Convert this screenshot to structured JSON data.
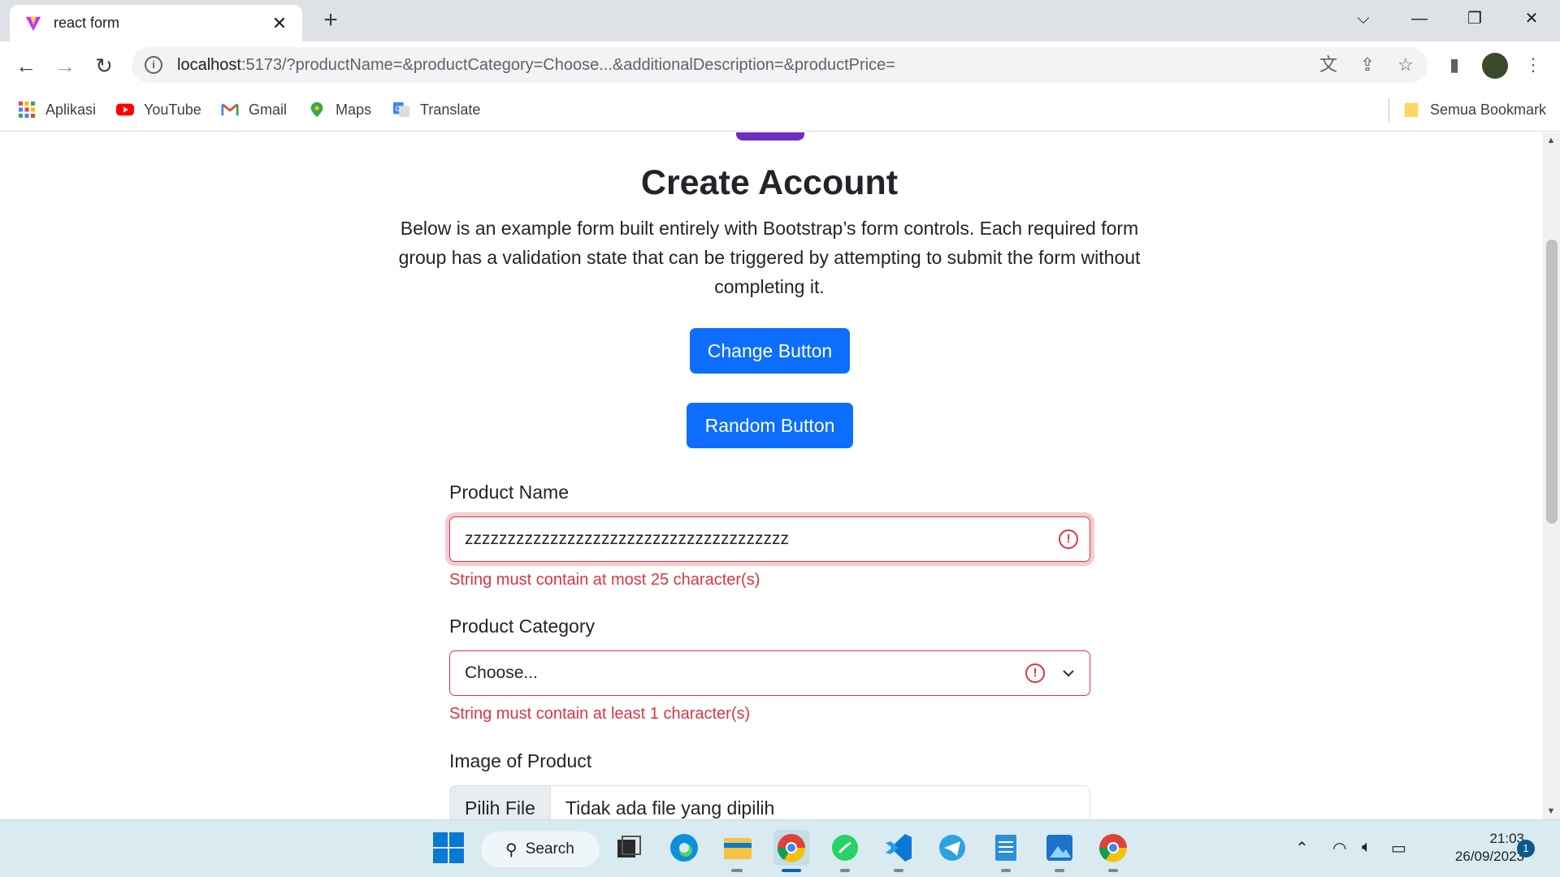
{
  "browser": {
    "tab_title": "react form",
    "url_host": "localhost",
    "url_rest": ":5173/?productName=&productCategory=Choose...&additionalDescription=&productPrice=",
    "bookmarks": [
      "Aplikasi",
      "YouTube",
      "Gmail",
      "Maps",
      "Translate"
    ],
    "all_bookmarks": "Semua Bookmark"
  },
  "page": {
    "title": "Create Account",
    "lead": "Below is an example form built entirely with Bootstrap’s form controls. Each required form group has a validation state that can be triggered by attempting to submit the form without completing it.",
    "change_button": "Change Button",
    "random_button": "Random Button",
    "product_name": {
      "label": "Product Name",
      "value": "zzzzzzzzzzzzzzzzzzzzzzzzzzzzzzzzzzzzzz",
      "error": "String must contain at most 25 character(s)"
    },
    "product_category": {
      "label": "Product Category",
      "value": "Choose...",
      "error": "String must contain at least 1 character(s)"
    },
    "product_image": {
      "label": "Image of Product",
      "button": "Pilih File",
      "status": "Tidak ada file yang dipilih"
    }
  },
  "taskbar": {
    "search_label": "Search",
    "time": "21:03",
    "date": "26/09/2023",
    "notification_count": "1"
  },
  "colors": {
    "primary": "#0d6efd",
    "danger": "#dc3545",
    "accent_purple": "#6f2dbd"
  }
}
